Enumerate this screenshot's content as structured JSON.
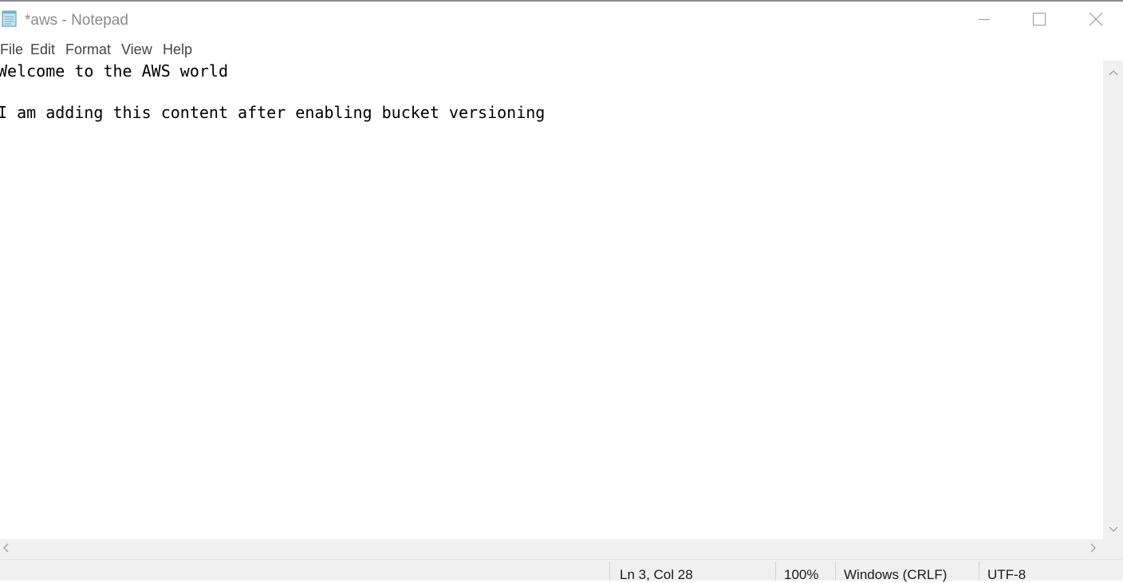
{
  "window": {
    "title": "*aws - Notepad",
    "icon": "notepad-icon",
    "controls": [
      "minimize-icon",
      "maximize-icon",
      "close-icon"
    ]
  },
  "menu": {
    "file": "File",
    "edit": "Edit",
    "format": "Format",
    "view": "View",
    "help": "Help"
  },
  "editor": {
    "content": "Welcome to the AWS world\n\nI am adding this content after enabling bucket versioning"
  },
  "status": {
    "position": "Ln 3, Col 28",
    "zoom": "100%",
    "line_ending": "Windows (CRLF)",
    "encoding": "UTF-8"
  },
  "colors": {
    "title_text": "#8b8b8b",
    "status_bar": "#f0f0f0",
    "scrollbar": "#f0f0f0"
  }
}
